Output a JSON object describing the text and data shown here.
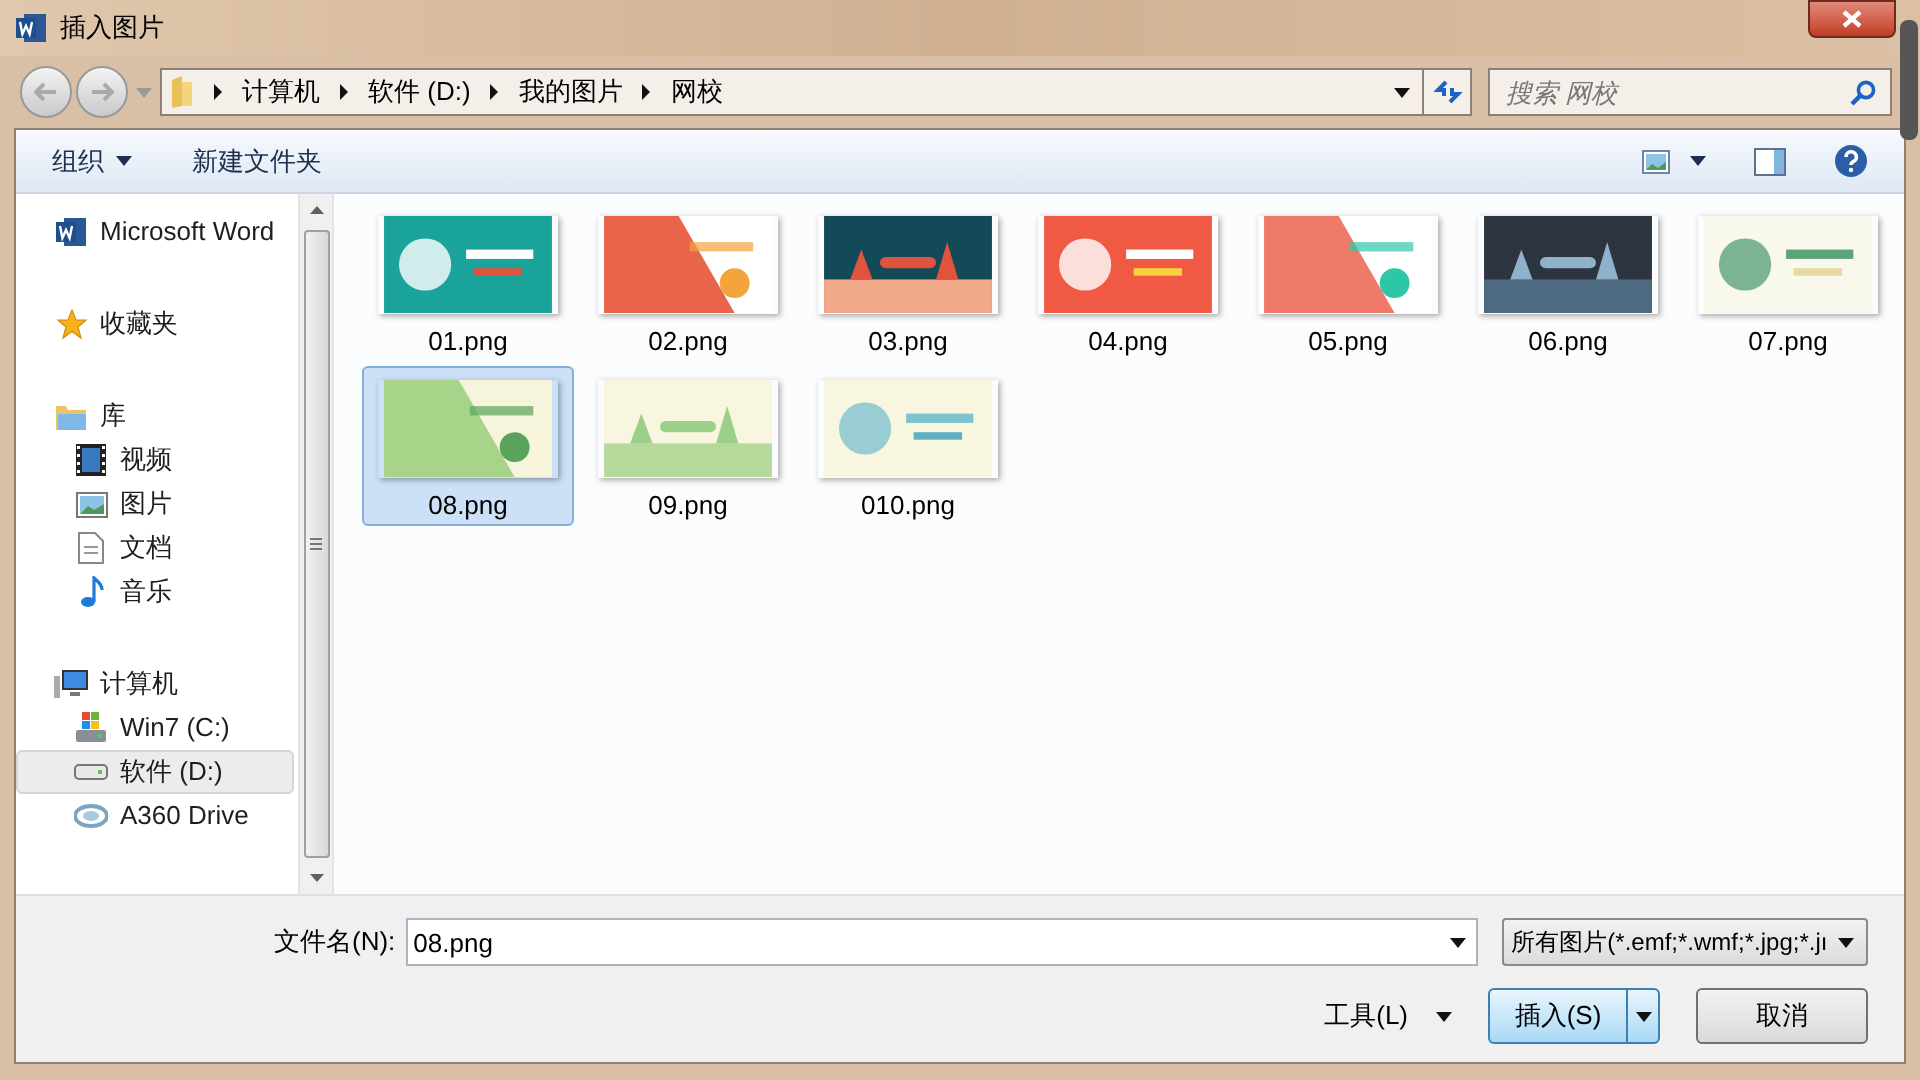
{
  "window": {
    "title": "插入图片"
  },
  "breadcrumb": [
    "计算机",
    "软件 (D:)",
    "我的图片",
    "网校"
  ],
  "search": {
    "placeholder": "搜索 网校"
  },
  "toolbar": [
    {
      "label": "组织",
      "dropdown": true
    },
    {
      "label": "新建文件夹",
      "dropdown": false
    }
  ],
  "sidebar": [
    {
      "label": "Microsoft Word",
      "kind": "word",
      "selected": false
    },
    {
      "label": "收藏夹",
      "kind": "star",
      "selected": false
    },
    {
      "label": "库",
      "kind": "library",
      "selected": false,
      "children": [
        {
          "label": "视频",
          "kind": "video",
          "selected": false
        },
        {
          "label": "图片",
          "kind": "pictures",
          "selected": false
        },
        {
          "label": "文档",
          "kind": "document",
          "selected": false
        },
        {
          "label": "音乐",
          "kind": "music",
          "selected": false
        }
      ]
    },
    {
      "label": "计算机",
      "kind": "computer",
      "selected": false,
      "children": [
        {
          "label": "Win7 (C:)",
          "kind": "system-drive",
          "selected": false
        },
        {
          "label": "软件 (D:)",
          "kind": "drive",
          "selected": true
        },
        {
          "label": "A360 Drive",
          "kind": "cloud",
          "selected": false
        }
      ]
    }
  ],
  "files": [
    {
      "name": "01.png",
      "selected": false
    },
    {
      "name": "02.png",
      "selected": false
    },
    {
      "name": "03.png",
      "selected": false
    },
    {
      "name": "04.png",
      "selected": false
    },
    {
      "name": "05.png",
      "selected": false
    },
    {
      "name": "06.png",
      "selected": false
    },
    {
      "name": "07.png",
      "selected": false
    },
    {
      "name": "08.png",
      "selected": true
    },
    {
      "name": "09.png",
      "selected": false
    },
    {
      "name": "010.png",
      "selected": false
    }
  ],
  "filename": {
    "label": "文件名(N):",
    "value": "08.png"
  },
  "filetype": {
    "value": "所有图片(*.emf;*.wmf;*.jpg;*.jı"
  },
  "tools": {
    "label": "工具(L)"
  },
  "buttons": [
    {
      "label": "插入(S)",
      "kind": "split"
    },
    {
      "label": "取消",
      "kind": "plain"
    }
  ]
}
